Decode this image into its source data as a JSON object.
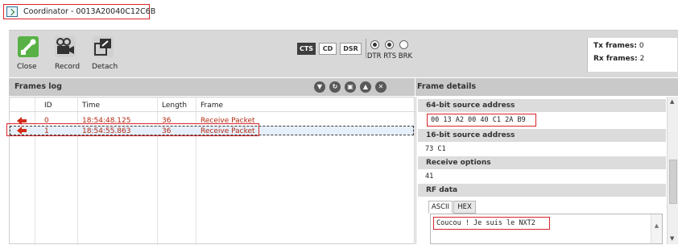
{
  "window": {
    "title": "Coordinator - 0013A20040C12C6B"
  },
  "toolbar": {
    "close_label": "Close",
    "record_label": "Record",
    "detach_label": "Detach",
    "signals": {
      "cts": "CTS",
      "cd": "CD",
      "dsr": "DSR",
      "lines_label": "DTR RTS BRK",
      "dtr_on": true,
      "rts_on": true,
      "brk_on": false
    },
    "tx_label": "Tx frames:",
    "tx_value": "0",
    "rx_label": "Rx frames:",
    "rx_value": "2"
  },
  "log": {
    "title": "Frames log",
    "columns": [
      "ID",
      "Time",
      "Length",
      "Frame"
    ],
    "rows": [
      {
        "id": "0",
        "time": "18:54:48.125",
        "length": "36",
        "frame": "Receive Packet"
      },
      {
        "id": "1",
        "time": "18:54:55.863",
        "length": "36",
        "frame": "Receive Packet"
      }
    ]
  },
  "details": {
    "title": "Frame details",
    "addr64_label": "64-bit source address",
    "addr64_value": "00 13 A2 00 40 C1 2A B9",
    "addr16_label": "16-bit source address",
    "addr16_value": "73 C1",
    "options_label": "Receive options",
    "options_value": "41",
    "rf_label": "RF data",
    "tab_ascii": "ASCII",
    "tab_hex": "HEX",
    "rf_text": "Coucou ! Je suis le NXT2"
  },
  "colors": {
    "accent_red": "#d9242a",
    "frame_text": "#b32a12",
    "close_green": "#58b146"
  }
}
